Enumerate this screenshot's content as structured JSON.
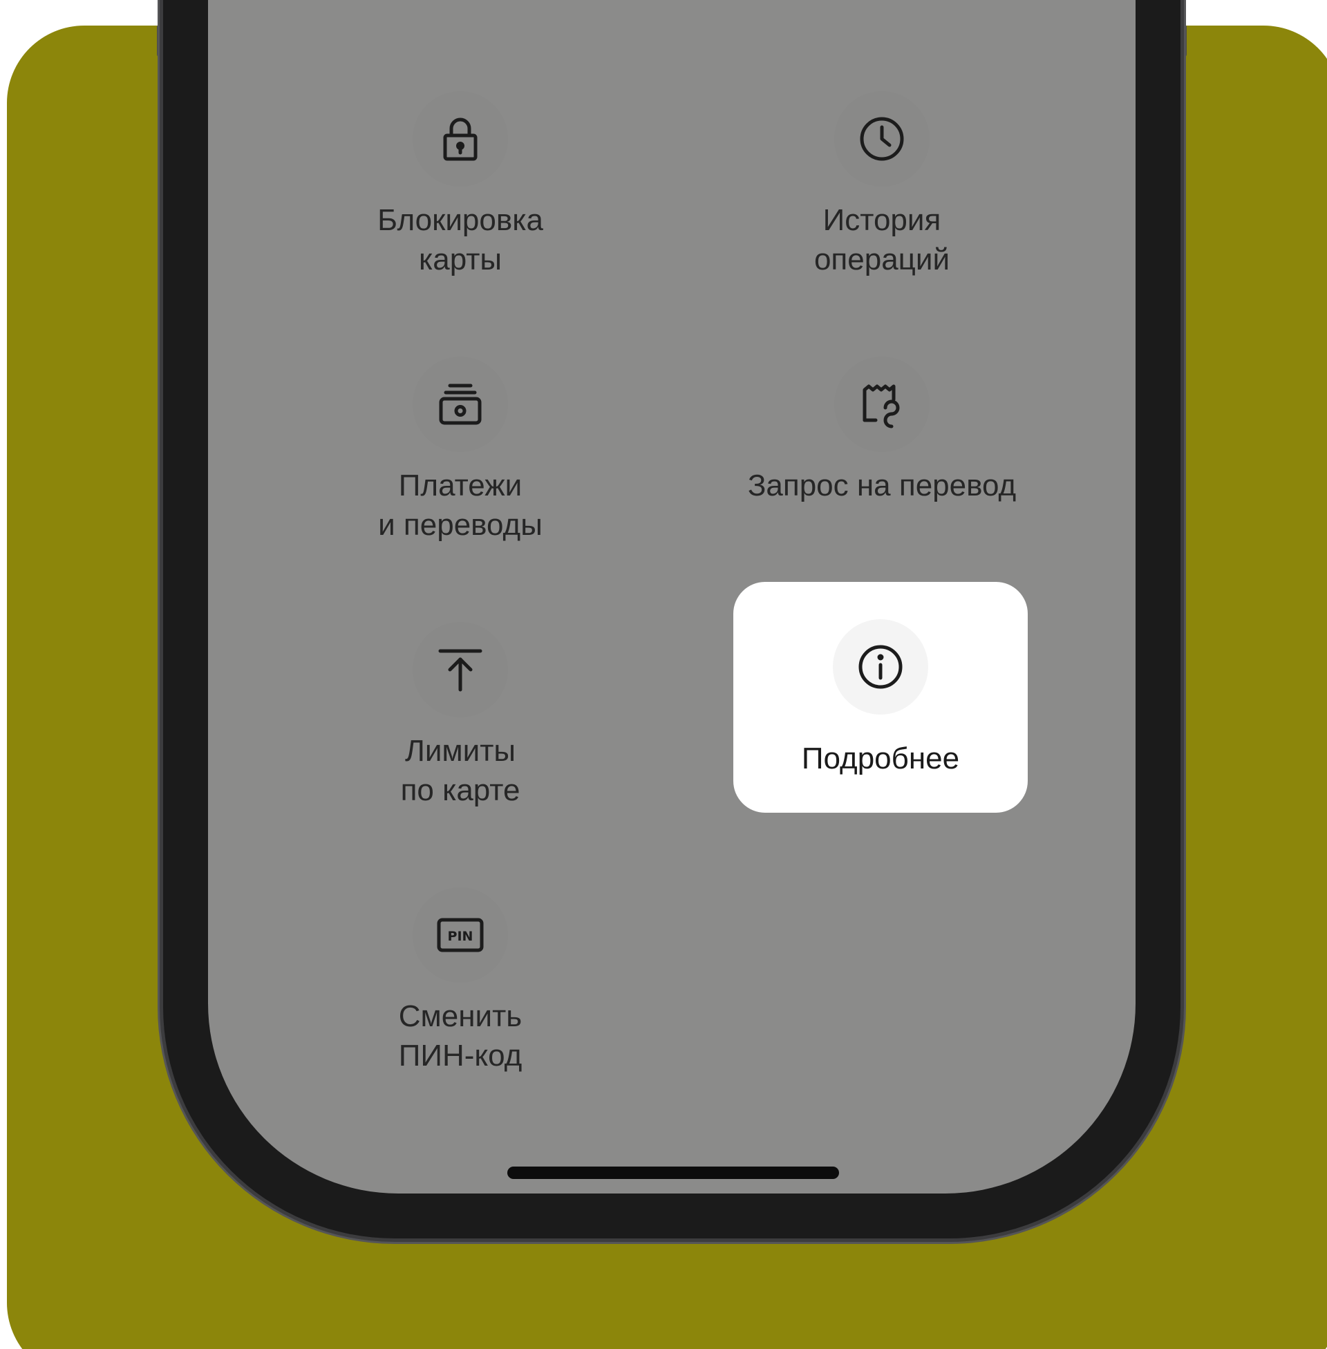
{
  "colors": {
    "background_accent": "#8c860b",
    "screen_overlay": "#8b8b8a",
    "highlight_card": "#ffffff",
    "text": "#262626"
  },
  "menu": {
    "items": [
      {
        "label": "Блокировка\nкарты",
        "icon": "lock-icon"
      },
      {
        "label": "История\nопераций",
        "icon": "clock-icon"
      },
      {
        "label": "Платежи\nи переводы",
        "icon": "payments-icon"
      },
      {
        "label": "Запрос на перевод",
        "icon": "transfer-request-icon"
      },
      {
        "label": "Лимиты\nпо карте",
        "icon": "limit-arrow-up-icon"
      },
      {
        "label": "Подробнее",
        "icon": "info-icon",
        "highlighted": true
      },
      {
        "label": "Сменить\nПИН-код",
        "icon": "pin-icon"
      }
    ]
  }
}
